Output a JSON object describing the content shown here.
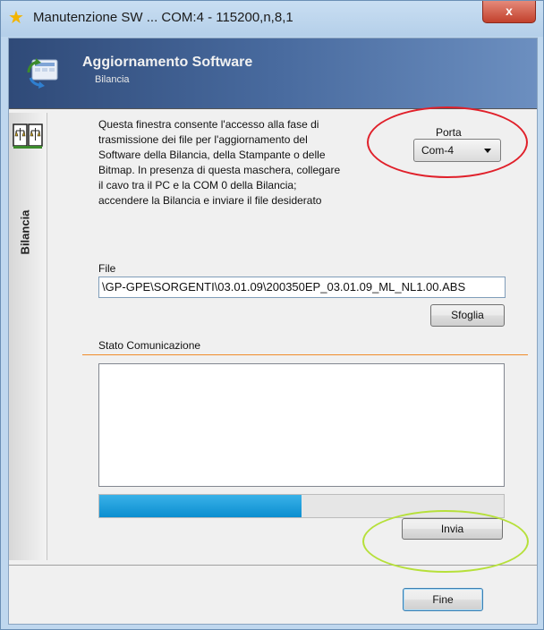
{
  "window": {
    "title": "Manutenzione SW ... COM:4 - 115200,n,8,1",
    "close_label": "x"
  },
  "header": {
    "title": "Aggiornamento Software",
    "subtitle": "Bilancia"
  },
  "sidebar": {
    "label": "Bilancia"
  },
  "description": {
    "lines": [
      "Questa finestra consente l'accesso alla fase di",
      "trasmissione dei file per l'aggiornamento del",
      "Software della Bilancia, della Stampante o delle",
      "Bitmap. In presenza di questa maschera, collegare",
      "il cavo tra il PC e la COM 0 della Bilancia;",
      "accendere la Bilancia e inviare il file desiderato"
    ]
  },
  "porta": {
    "label": "Porta",
    "selected": "Com-4"
  },
  "file": {
    "label": "File",
    "value": "\\GP-GPE\\SORGENTI\\03.01.09\\200350EP_03.01.09_ML_NL1.00.ABS",
    "browse_label": "Sfoglia"
  },
  "stato": {
    "label": "Stato Comunicazione",
    "log": "",
    "progress": 0.5
  },
  "buttons": {
    "invia": "Invia",
    "fine": "Fine"
  },
  "colors": {
    "highlight_red": "#e0202a",
    "highlight_green": "#b6e03a",
    "progress": "#1a9ad8",
    "separator": "#f08c2a"
  }
}
